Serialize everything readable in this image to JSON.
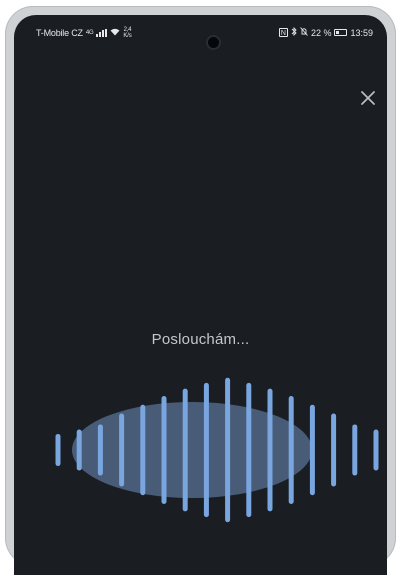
{
  "status_bar": {
    "carrier": "T-Mobile CZ",
    "network_type": "4G",
    "data_speed_value": "2,4",
    "data_speed_unit": "K/s",
    "battery": "22 %",
    "time": "13:59"
  },
  "assistant": {
    "status_text": "Poslouchám..."
  },
  "waveform": {
    "bar_levels": [
      0.22,
      0.28,
      0.35,
      0.5,
      0.62,
      0.74,
      0.84,
      0.92,
      0.99,
      0.92,
      0.84,
      0.74,
      0.62,
      0.5,
      0.35,
      0.28,
      0.22
    ],
    "bar_color": "#7aa6e0",
    "blob_color": "#6f8fc0"
  },
  "colors": {
    "background": "#1a1d22",
    "text": "#c4c7cb"
  }
}
